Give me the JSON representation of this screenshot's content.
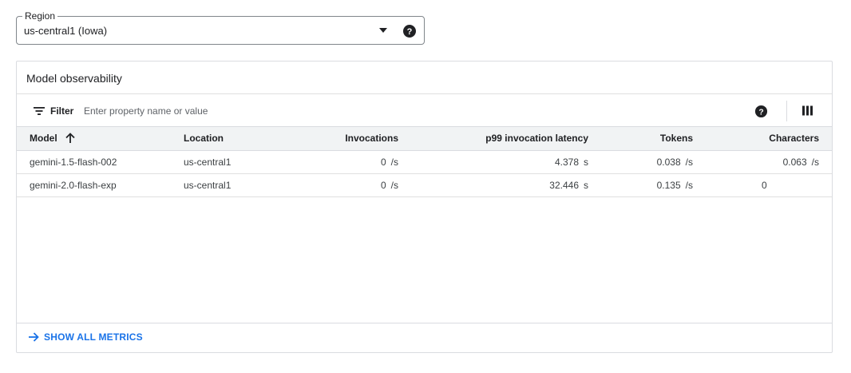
{
  "region": {
    "label": "Region",
    "value": "us-central1 (Iowa)"
  },
  "card": {
    "title": "Model observability",
    "filter": {
      "label": "Filter",
      "placeholder": "Enter property name or value"
    },
    "columns": [
      "Model",
      "Location",
      "Invocations",
      "p99 invocation latency",
      "Tokens",
      "Characters"
    ],
    "sort": {
      "column": "Model",
      "direction": "ascending"
    },
    "rows": [
      {
        "model": "gemini-1.5-flash-002",
        "location": "us-central1",
        "invocations": "0",
        "invocations_unit": "/s",
        "latency": "4.378",
        "latency_unit": "s",
        "tokens": "0.038",
        "tokens_unit": "/s",
        "characters": "0.063",
        "characters_unit": "/s"
      },
      {
        "model": "gemini-2.0-flash-exp",
        "location": "us-central1",
        "invocations": "0",
        "invocations_unit": "/s",
        "latency": "32.446",
        "latency_unit": "s",
        "tokens": "0.135",
        "tokens_unit": "/s",
        "characters": "0",
        "characters_unit": ""
      }
    ],
    "footer_link": "SHOW ALL METRICS"
  },
  "colors": {
    "accent": "#1a73e8",
    "header_bg": "#f1f3f4",
    "border": "#dadce0"
  }
}
